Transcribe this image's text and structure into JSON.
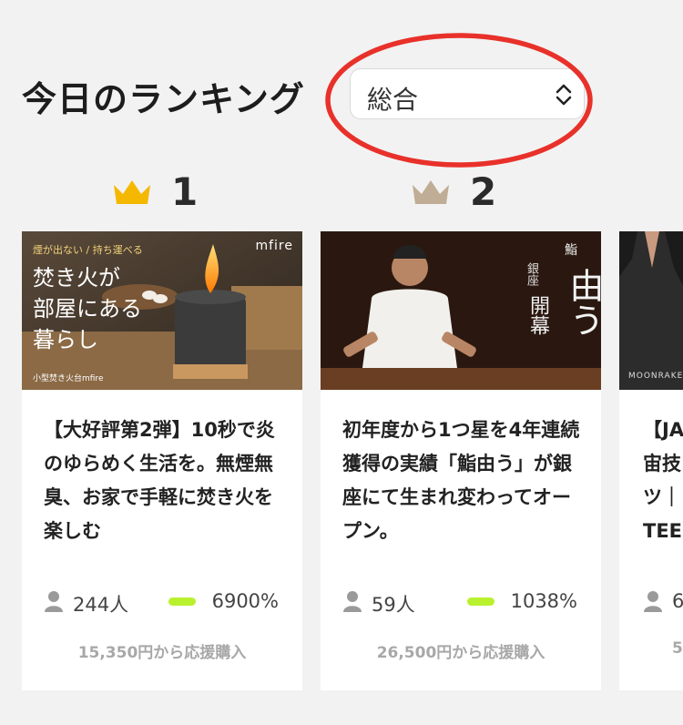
{
  "header": {
    "title": "今日のランキング",
    "category_select": {
      "value": "総合"
    }
  },
  "colors": {
    "gold_crown": "#f5b800",
    "silver_crown": "#c0ad96",
    "highlight_oval": "#e8312a",
    "progress_green": "#b9f12f",
    "background": "#f2f2f2"
  },
  "ranking": [
    {
      "rank": "1",
      "image_text": {
        "tag": "煙が出ない / 持ち運べる",
        "brand": "mfire",
        "headline": [
          "焚き火が",
          "部屋にある",
          "暮らし"
        ],
        "caption": "小型焚き火台mfire"
      },
      "description": "【大好評第2弾】10秒で炎のゆらめく生活を。無煙無臭、お家で手軽に焚き火を楽しむ",
      "supporters": "244人",
      "percent": "6900%",
      "price": "15,350円から応援購入"
    },
    {
      "rank": "2",
      "image_text": {
        "line1": "鮨",
        "line2": "銀座",
        "line3": "開幕",
        "line4": "由う"
      },
      "description": "初年度から1つ星を4年連続獲得の実績「鮨由う」が銀座にて生まれ変わってオープン。",
      "supporters": "59人",
      "percent": "1038%",
      "price": "26,500円から応援購入"
    },
    {
      "image_text": {
        "brand": "MOONRAKER"
      },
      "description_lines": [
        "【JA",
        "宙技",
        "ツ｜",
        "TEE"
      ],
      "supporters": "6",
      "price": "5"
    }
  ]
}
